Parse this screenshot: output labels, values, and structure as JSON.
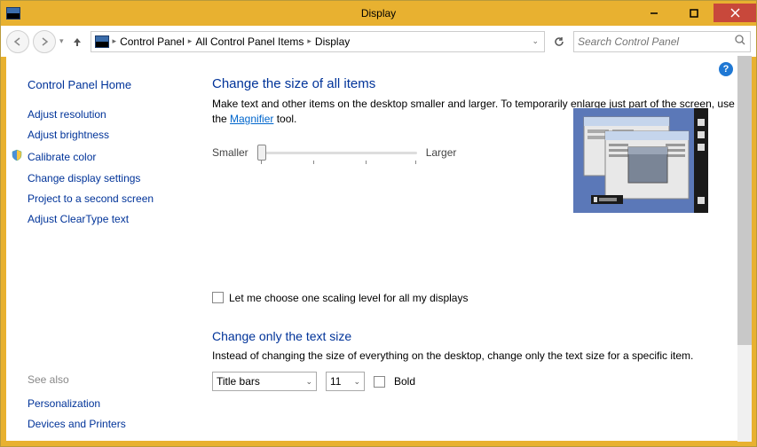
{
  "window": {
    "title": "Display"
  },
  "breadcrumb": {
    "items": [
      "Control Panel",
      "All Control Panel Items",
      "Display"
    ]
  },
  "search": {
    "placeholder": "Search Control Panel"
  },
  "sidebar": {
    "home": "Control Panel Home",
    "links": [
      "Adjust resolution",
      "Adjust brightness",
      "Calibrate color",
      "Change display settings",
      "Project to a second screen",
      "Adjust ClearType text"
    ],
    "see_also_label": "See also",
    "see_also": [
      "Personalization",
      "Devices and Printers"
    ]
  },
  "main": {
    "heading1": "Change the size of all items",
    "desc1_a": "Make text and other items on the desktop smaller and larger. To temporarily enlarge just part of the screen, use the ",
    "desc1_link": "Magnifier",
    "desc1_b": " tool.",
    "slider_min": "Smaller",
    "slider_max": "Larger",
    "checkbox1": "Let me choose one scaling level for all my displays",
    "heading2": "Change only the text size",
    "desc2": "Instead of changing the size of everything on the desktop, change only the text size for a specific item.",
    "element_select": "Title bars",
    "size_select": "11",
    "bold_label": "Bold"
  }
}
